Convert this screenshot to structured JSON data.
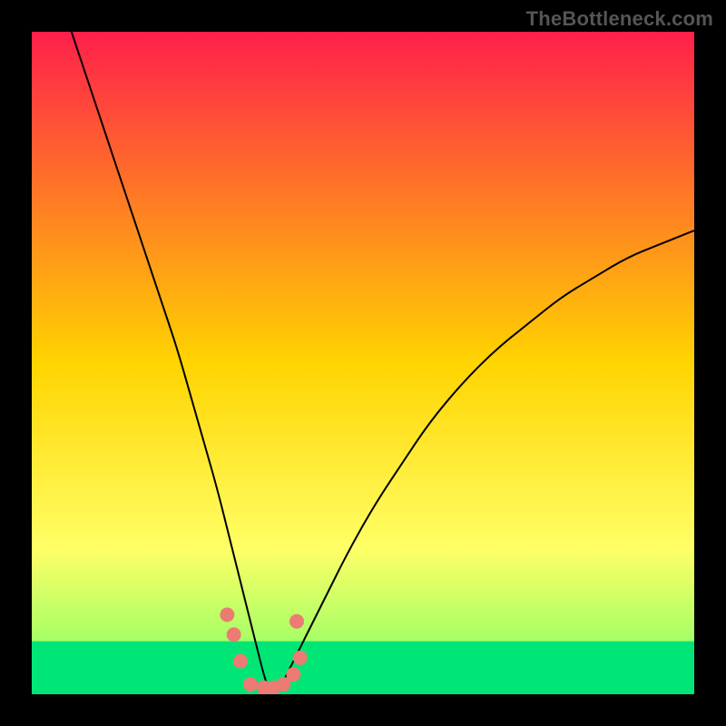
{
  "watermark": "TheBottleneck.com",
  "chart_data": {
    "type": "line",
    "title": "",
    "xlabel": "",
    "ylabel": "",
    "xlim": [
      0,
      100
    ],
    "ylim": [
      0,
      100
    ],
    "legend": false,
    "grid": false,
    "background_gradient": {
      "direction": "vertical",
      "stops": [
        {
          "pos": 0.0,
          "color": "#ff1f4b"
        },
        {
          "pos": 0.5,
          "color": "#ffd400"
        },
        {
          "pos": 0.78,
          "color": "#ffff66"
        },
        {
          "pos": 0.94,
          "color": "#99ff66"
        },
        {
          "pos": 1.0,
          "color": "#00e676"
        }
      ]
    },
    "green_band": {
      "y_start": 0,
      "y_end": 8
    },
    "series": [
      {
        "name": "bottleneck-curve",
        "stroke": "#000000",
        "stroke_width": 2,
        "x": [
          6,
          8,
          10,
          12,
          14,
          16,
          18,
          20,
          22,
          24,
          26,
          28,
          30,
          32,
          34,
          35,
          36,
          37,
          38,
          40,
          44,
          48,
          52,
          56,
          60,
          65,
          70,
          75,
          80,
          85,
          90,
          95,
          100
        ],
        "y": [
          100,
          94,
          88,
          82,
          76,
          70,
          64,
          58,
          52,
          45,
          38,
          31,
          23,
          15,
          7,
          3,
          0,
          0,
          2,
          6,
          14,
          22,
          29,
          35,
          41,
          47,
          52,
          56,
          60,
          63,
          66,
          68,
          70
        ]
      }
    ],
    "markers": {
      "name": "highlight-dots",
      "color": "#ec7b73",
      "radius_px": 8,
      "points": [
        {
          "x": 29.5,
          "y": 12
        },
        {
          "x": 30.5,
          "y": 9
        },
        {
          "x": 31.5,
          "y": 5
        },
        {
          "x": 33.0,
          "y": 1.5
        },
        {
          "x": 35.0,
          "y": 1.0
        },
        {
          "x": 36.5,
          "y": 1.0
        },
        {
          "x": 38.0,
          "y": 1.5
        },
        {
          "x": 39.5,
          "y": 3.0
        },
        {
          "x": 40.5,
          "y": 5.5
        },
        {
          "x": 40.0,
          "y": 11
        }
      ]
    }
  }
}
